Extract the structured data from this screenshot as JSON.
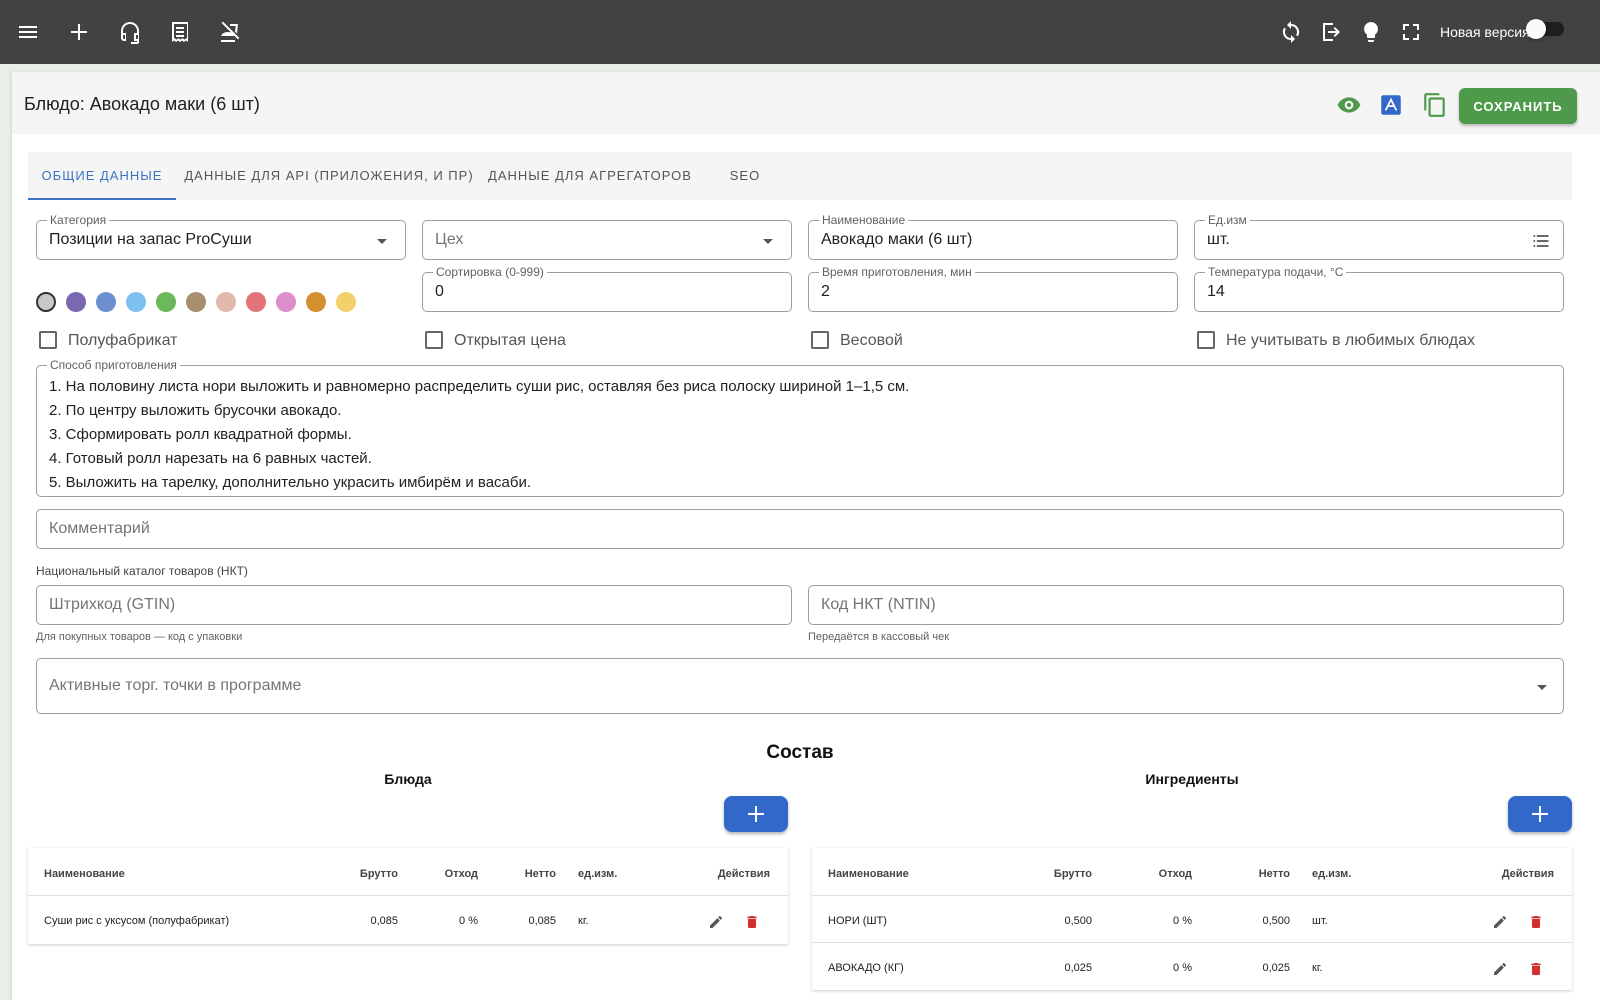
{
  "topbar": {
    "new_version_label": "Новая версия"
  },
  "header": {
    "title": "Блюдо: Авокадо маки (6 шт)",
    "save_label": "СОХРАНИТЬ"
  },
  "tabs": [
    {
      "label": "ОБЩИЕ ДАННЫЕ"
    },
    {
      "label": "ДАННЫЕ ДЛЯ API (ПРИЛОЖЕНИЯ, И ПР)"
    },
    {
      "label": "ДАННЫЕ ДЛЯ АГРЕГАТОРОВ"
    },
    {
      "label": "SEO"
    }
  ],
  "form": {
    "category": {
      "label": "Категория",
      "value": "Позиции на запас ProСуши"
    },
    "workshop": {
      "placeholder": "Цех"
    },
    "name": {
      "label": "Наименование",
      "value": "Авокадо маки (6 шт)"
    },
    "unit": {
      "label": "Ед.изм",
      "value": "шт."
    },
    "sort": {
      "label": "Сортировка (0-999)",
      "value": "0"
    },
    "cook_time": {
      "label": "Время приготовления, мин",
      "value": "2"
    },
    "temperature": {
      "label": "Температура подачи, °С",
      "value": "14"
    },
    "colors": [
      "#c8c8c8",
      "#7b68b0",
      "#6d8fd0",
      "#7ec0ef",
      "#6cb85a",
      "#a88f6e",
      "#e2b8ad",
      "#e07478",
      "#dc8fcb",
      "#d48f30",
      "#f4d06a"
    ],
    "checkboxes": [
      {
        "label": "Полуфабрикат"
      },
      {
        "label": "Открытая цена"
      },
      {
        "label": "Весовой"
      },
      {
        "label": "Не учитывать в любимых блюдах"
      }
    ],
    "recipe": {
      "label": "Способ приготовления",
      "lines": [
        "1. На половину листа нори выложить и равномерно распределить суши рис, оставляя без риса полоску шириной 1–1,5 см.",
        "2. По центру выложить брусочки авокадо.",
        "3. Сформировать ролл квадратной формы.",
        "4. Готовый ролл нарезать на 6 равных частей.",
        "5. Выложить на тарелку, дополнительно украсить имбирём и васаби."
      ]
    },
    "comment": {
      "placeholder": "Комментарий"
    },
    "nkt": {
      "section_label": "Национальный каталог товаров (НКТ)",
      "gtin_placeholder": "Штрихкод (GTIN)",
      "gtin_hint": "Для покупных товаров — код с упаковки",
      "ntin_placeholder": "Код НКТ (NTIN)",
      "ntin_hint": "Передаётся в кассовый чек"
    },
    "outlets": {
      "placeholder": "Активные торг. точки в программе"
    }
  },
  "composition": {
    "title": "Состав",
    "dishes": {
      "title": "Блюда",
      "headers": [
        "Наименование",
        "Брутто",
        "Отход",
        "Нетто",
        "ед.изм.",
        "Действия"
      ],
      "rows": [
        {
          "name": "Суши рис с уксусом (полуфабрикат)",
          "gross": "0,085",
          "waste": "0 %",
          "net": "0,085",
          "unit": "кг."
        }
      ]
    },
    "ingredients": {
      "title": "Ингредиенты",
      "headers": [
        "Наименование",
        "Брутто",
        "Отход",
        "Нетто",
        "ед.изм.",
        "Действия"
      ],
      "rows": [
        {
          "name": "НОРИ (ШТ)",
          "gross": "0,500",
          "waste": "0 %",
          "net": "0,500",
          "unit": "шт."
        },
        {
          "name": "АВОКАДО (КГ)",
          "gross": "0,025",
          "waste": "0 %",
          "net": "0,025",
          "unit": "кг."
        }
      ]
    }
  },
  "colors": {
    "topbar": "#424242",
    "accent_blue": "#3d73c7",
    "save_green": "#4c9a4a",
    "delete_red": "#d32f2f"
  }
}
